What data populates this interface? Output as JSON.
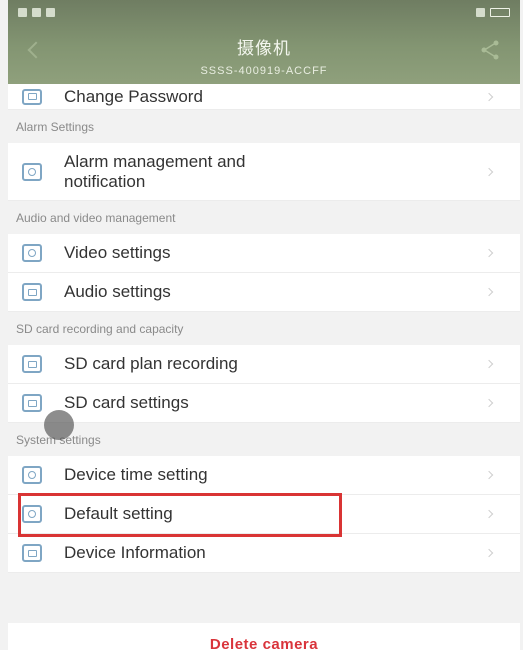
{
  "header": {
    "title": "摄像机",
    "subtitle": "SSSS-400919-ACCFF"
  },
  "icons": {
    "back": "back-arrow-icon",
    "share": "share-icon",
    "lock": "lock-icon",
    "alarm": "alarm-icon",
    "video": "camera-icon",
    "audio": "speaker-icon",
    "sd_plan": "record-icon",
    "sd_settings": "sd-card-icon",
    "time": "clock-icon",
    "default": "reset-icon",
    "info": "info-icon"
  },
  "items": {
    "change_password": "Change Password",
    "alarm_section": "Alarm Settings",
    "alarm_mgmt_line1": "Alarm management and",
    "alarm_mgmt_line2": "notification",
    "av_section": "Audio and video management",
    "video_settings": "Video settings",
    "audio_settings": "Audio settings",
    "sd_section": "SD card recording and capacity",
    "sd_plan": "SD card plan recording",
    "sd_settings": "SD card settings",
    "system_section": "System settings",
    "device_time": "Device time setting",
    "default_setting": "Default setting",
    "device_info": "Device Information"
  },
  "footer": {
    "delete_label": "Delete camera"
  },
  "colors": {
    "accent_icon": "#7fa6c4",
    "delete_red": "#d9343b",
    "highlight_red": "#d93434",
    "header_green": "#839572"
  }
}
